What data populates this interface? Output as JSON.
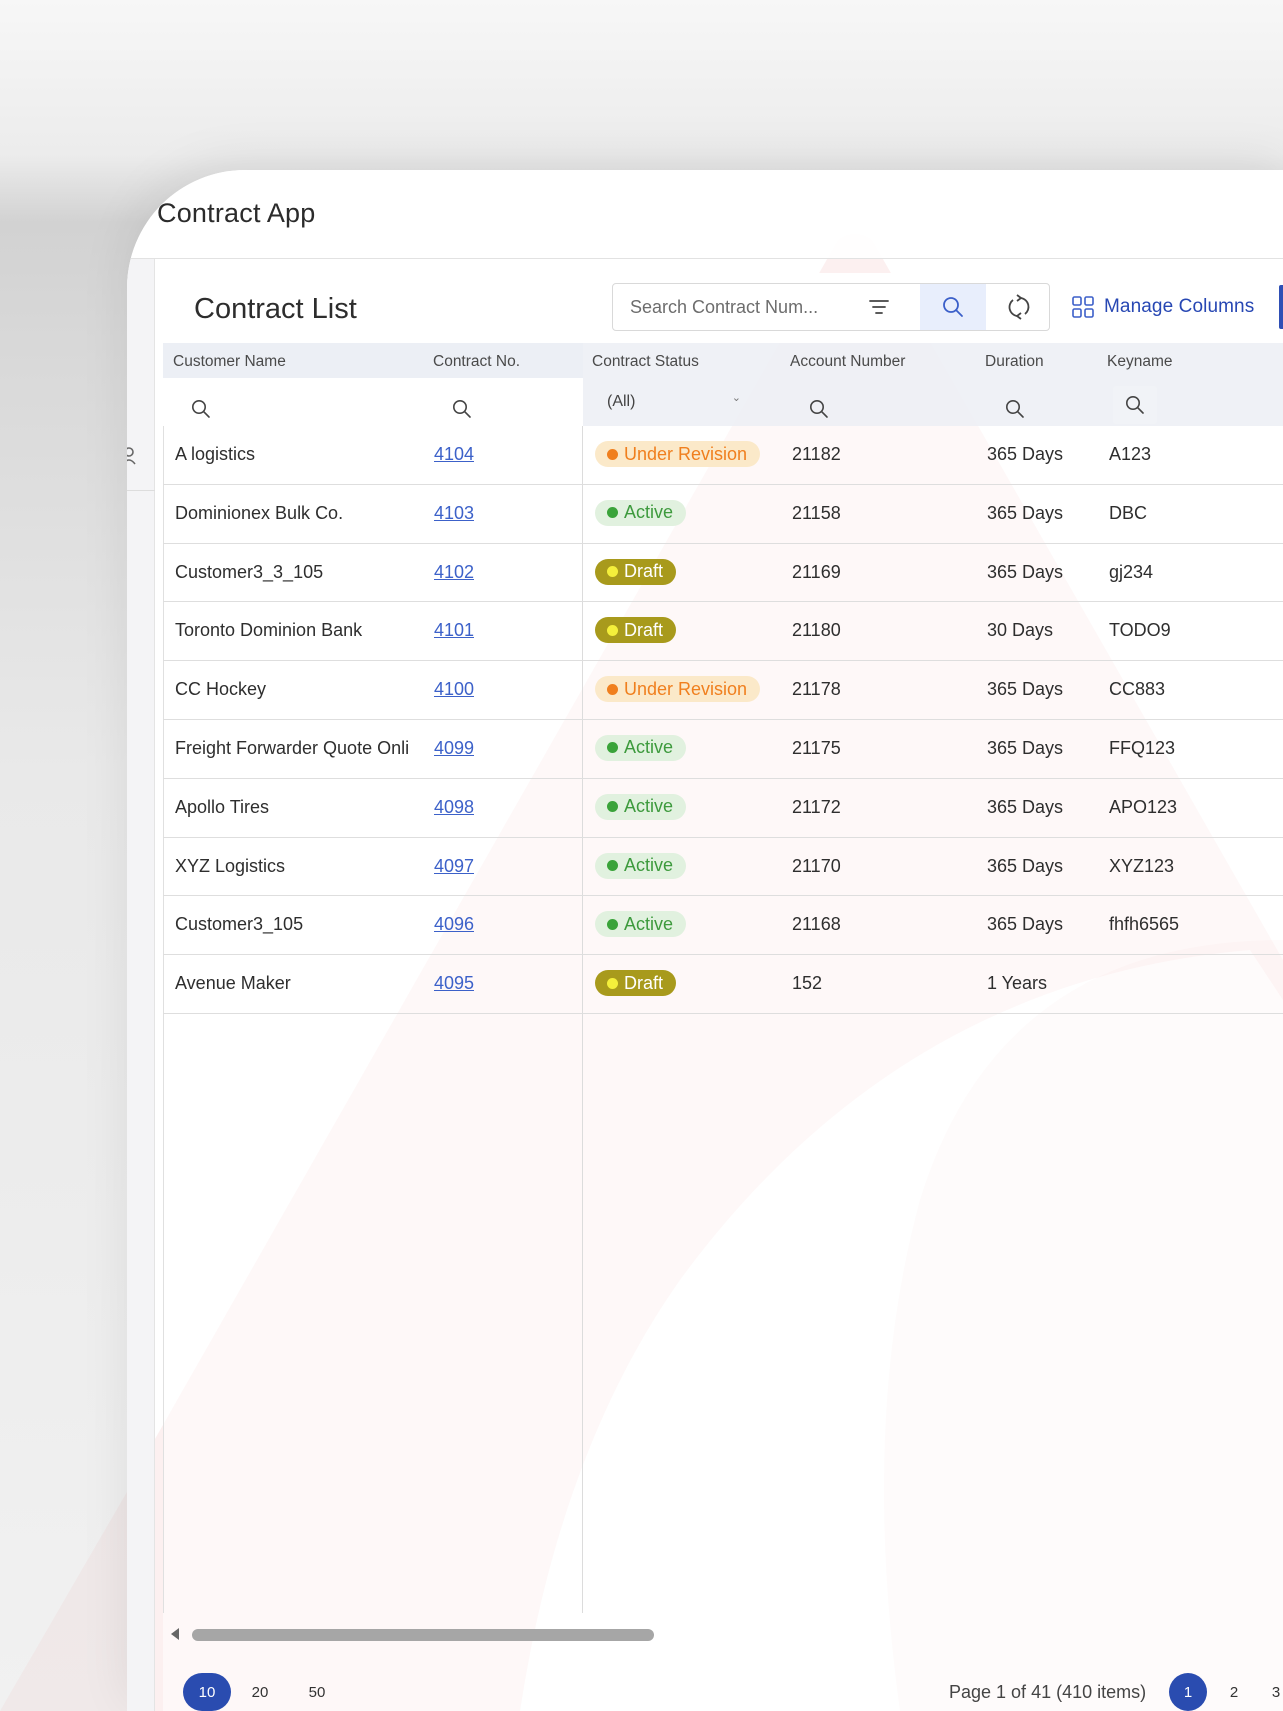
{
  "app": {
    "title": "Contract App"
  },
  "toolbar": {
    "title": "Contract List",
    "search_placeholder": "Search Contract Num...",
    "manage_columns_label": "Manage Columns"
  },
  "columns": {
    "customer_name": "Customer Name",
    "contract_no": "Contract No.",
    "contract_status": "Contract Status",
    "account_number": "Account Number",
    "duration": "Duration",
    "keyname": "Keyname"
  },
  "status_filter": {
    "selected": "(All)"
  },
  "status_colors": {
    "Under Revision": {
      "bg": "#fbe9c9",
      "fg": "#f07f1e",
      "dot": "#f07f1e"
    },
    "Active": {
      "bg": "#e1f1df",
      "fg": "#3d9a3d",
      "dot": "#3aa33a"
    },
    "Draft": {
      "bg": "#a89a1c",
      "fg": "#ffffff",
      "dot": "#f4ef3b"
    }
  },
  "rows": [
    {
      "customer_name": "A logistics",
      "contract_no": "4104",
      "status": "Under Revision",
      "account_number": "21182",
      "duration": "365 Days",
      "keyname": "A123"
    },
    {
      "customer_name": "Dominionex Bulk Co.",
      "contract_no": "4103",
      "status": "Active",
      "account_number": "21158",
      "duration": "365 Days",
      "keyname": "DBC"
    },
    {
      "customer_name": "Customer3_3_105",
      "contract_no": "4102",
      "status": "Draft",
      "account_number": "21169",
      "duration": "365 Days",
      "keyname": "gj234"
    },
    {
      "customer_name": "Toronto Dominion Bank",
      "contract_no": "4101",
      "status": "Draft",
      "account_number": "21180",
      "duration": "30 Days",
      "keyname": "TODO9"
    },
    {
      "customer_name": "CC Hockey",
      "contract_no": "4100",
      "status": "Under Revision",
      "account_number": "21178",
      "duration": "365 Days",
      "keyname": "CC883"
    },
    {
      "customer_name": "Freight Forwarder Quote Onli",
      "contract_no": "4099",
      "status": "Active",
      "account_number": "21175",
      "duration": "365 Days",
      "keyname": "FFQ123"
    },
    {
      "customer_name": "Apollo Tires",
      "contract_no": "4098",
      "status": "Active",
      "account_number": "21172",
      "duration": "365 Days",
      "keyname": "APO123"
    },
    {
      "customer_name": "XYZ Logistics",
      "contract_no": "4097",
      "status": "Active",
      "account_number": "21170",
      "duration": "365 Days",
      "keyname": "XYZ123"
    },
    {
      "customer_name": "Customer3_105",
      "contract_no": "4096",
      "status": "Active",
      "account_number": "21168",
      "duration": "365 Days",
      "keyname": "fhfh6565"
    },
    {
      "customer_name": "Avenue Maker",
      "contract_no": "4095",
      "status": "Draft",
      "account_number": "152",
      "duration": "1 Years",
      "keyname": ""
    }
  ],
  "pager": {
    "page_sizes": [
      "10",
      "20",
      "50"
    ],
    "selected_size": "10",
    "info": "Page 1 of 41 (410 items)",
    "pages": [
      "1",
      "2",
      "3"
    ],
    "current_page": "1"
  },
  "accent_color": "#2a4cb0"
}
